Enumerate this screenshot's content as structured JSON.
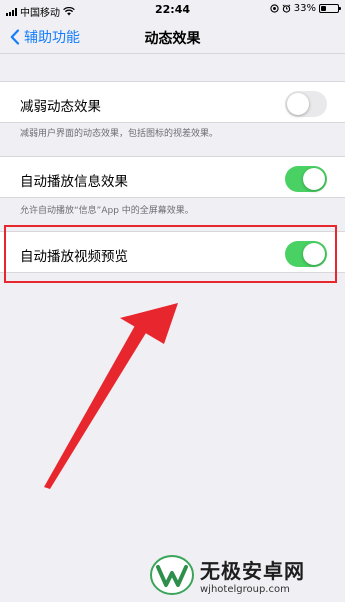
{
  "status_bar": {
    "carrier": "中国移动",
    "time": "22:44",
    "battery_text": "33%",
    "battery_level": 0.33,
    "icons": [
      "signal-icon",
      "wifi-icon",
      "location-icon",
      "alarm-icon",
      "battery-icon"
    ]
  },
  "nav": {
    "back_label": "辅助功能",
    "title": "动态效果"
  },
  "settings": {
    "reduce_motion": {
      "label": "减弱动态效果",
      "enabled": false,
      "footnote": "减弱用户界面的动态效果，包括图标的视差效果。"
    },
    "auto_play_messages": {
      "label": "自动播放信息效果",
      "enabled": true,
      "footnote": "允许自动播放“信息”App 中的全屏幕效果。"
    },
    "auto_play_video_previews": {
      "label": "自动播放视频预览",
      "enabled": true
    }
  },
  "colors": {
    "accent": "#157efb",
    "toggle_on": "#4ad163",
    "annotation_red": "#e8262e",
    "background": "#efeff4"
  },
  "watermark": {
    "title": "无极安卓网",
    "url": "wjhotelgroup.com"
  }
}
